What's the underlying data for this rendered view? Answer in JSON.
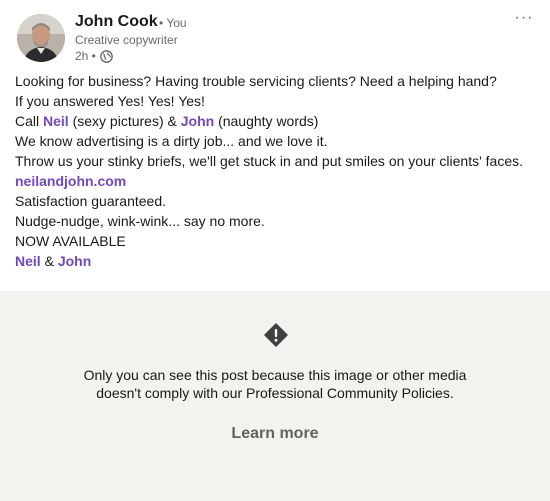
{
  "author": {
    "name": "John Cook",
    "relation": "• You",
    "headline": "Creative copywriter",
    "time": "2h •",
    "visibility_icon": "globe-icon"
  },
  "menu": {
    "more_label": "···"
  },
  "post": {
    "line1": "Looking for business? Having trouble servicing clients? Need a helping hand?",
    "line2": "If you answered Yes! Yes! Yes!",
    "line3_prefix": "Call ",
    "line3_neil": "Neil",
    "line3_mid": " (sexy pictures) & ",
    "line3_john": "John",
    "line3_suffix": " (naughty words)",
    "line4": "We know advertising is a dirty job... and we love it.",
    "line5": "Throw us your stinky briefs, we'll get stuck in and put smiles on your clients' faces.",
    "website": "neilandjohn.com",
    "line7": "Satisfaction guaranteed.",
    "line8": "Nudge-nudge, wink-wink... say no more.",
    "line9": "NOW AVAILABLE",
    "sig_neil": "Neil",
    "sig_amp": " & ",
    "sig_john": "John"
  },
  "restriction": {
    "icon": "warning-icon",
    "message_line1": "Only you can see this post because this image or other media",
    "message_line2": "doesn't comply with our Professional Community Policies.",
    "learn_more": "Learn more"
  },
  "colors": {
    "link": "#7347c1",
    "restricted_bg": "#f3f2ef"
  }
}
